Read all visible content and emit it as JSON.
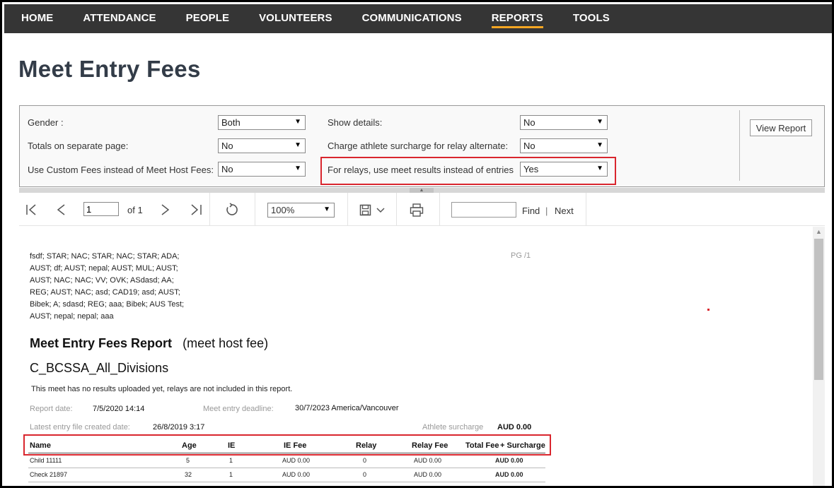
{
  "nav": {
    "items": [
      "HOME",
      "ATTENDANCE",
      "PEOPLE",
      "VOLUNTEERS",
      "COMMUNICATIONS",
      "REPORTS",
      "TOOLS"
    ],
    "active": "REPORTS",
    "accent": "#f5a623"
  },
  "page": {
    "title": "Meet Entry Fees"
  },
  "params": {
    "gender": {
      "label": "Gender :",
      "value": "Both"
    },
    "totals": {
      "label": "Totals on separate page:",
      "value": "No"
    },
    "custom_fees": {
      "label": "Use Custom Fees instead of Meet Host Fees:",
      "value": "No"
    },
    "show_details": {
      "label": "Show details:",
      "value": "No"
    },
    "surcharge_relay": {
      "label": "Charge athlete surcharge for relay alternate:",
      "value": "No"
    },
    "relay_results": {
      "label": "For relays, use meet results instead of entries",
      "value": "Yes"
    },
    "view_report": "View Report",
    "highlight_color": "#d9262e"
  },
  "toolbar": {
    "page_value": "1",
    "of_label": "of 1",
    "zoom": "100%",
    "find_label": "Find",
    "separator": "|",
    "next_label": "Next",
    "icons": [
      "first-page-icon",
      "prev-page-icon",
      "next-page-icon",
      "last-page-icon",
      "refresh-icon",
      "save-icon",
      "print-icon"
    ]
  },
  "report": {
    "divisions": "fsdf; STAR; NAC; STAR; NAC; STAR; ADA; AUST; df; AUST; nepal; AUST; MUL; AUST; AUST; NAC; NAC; VV; OVK; ASdasd; AA; REG; AUST; NAC; asd; CAD19; asd; AUST; Bibek; A; sdasd; REG; aaa; Bibek; AUS Test; AUST; nepal; nepal; aaa",
    "page_marker": "PG /1",
    "title": "Meet Entry Fees Report",
    "subtitle": "(meet host fee)",
    "meet_name": "C_BCSSA_All_Divisions",
    "note": "This meet has no results uploaded yet, relays are not included in this report.",
    "report_date_label": "Report date:",
    "report_date": "7/5/2020 14:14",
    "deadline_label": "Meet entry deadline:",
    "deadline": "30/7/2023 America/Vancouver",
    "latest_file_label": "Latest entry file created date:",
    "latest_file": "26/8/2019 3:17",
    "surcharge_label": "Athlete surcharge",
    "surcharge": "AUD 0.00",
    "columns": [
      "Name",
      "Age",
      "IE",
      "IE Fee",
      "Relay",
      "Relay Fee",
      "Total Fee",
      "+ Surcharge"
    ],
    "rows": [
      {
        "name": "Child 11111",
        "age": "5",
        "ie": "1",
        "ie_fee": "AUD 0.00",
        "relay": "0",
        "relay_fee": "AUD 0.00",
        "total": "AUD 0.00"
      },
      {
        "name": "Check 21897",
        "age": "32",
        "ie": "1",
        "ie_fee": "AUD 0.00",
        "relay": "0",
        "relay_fee": "AUD 0.00",
        "total": "AUD 0.00"
      }
    ]
  }
}
